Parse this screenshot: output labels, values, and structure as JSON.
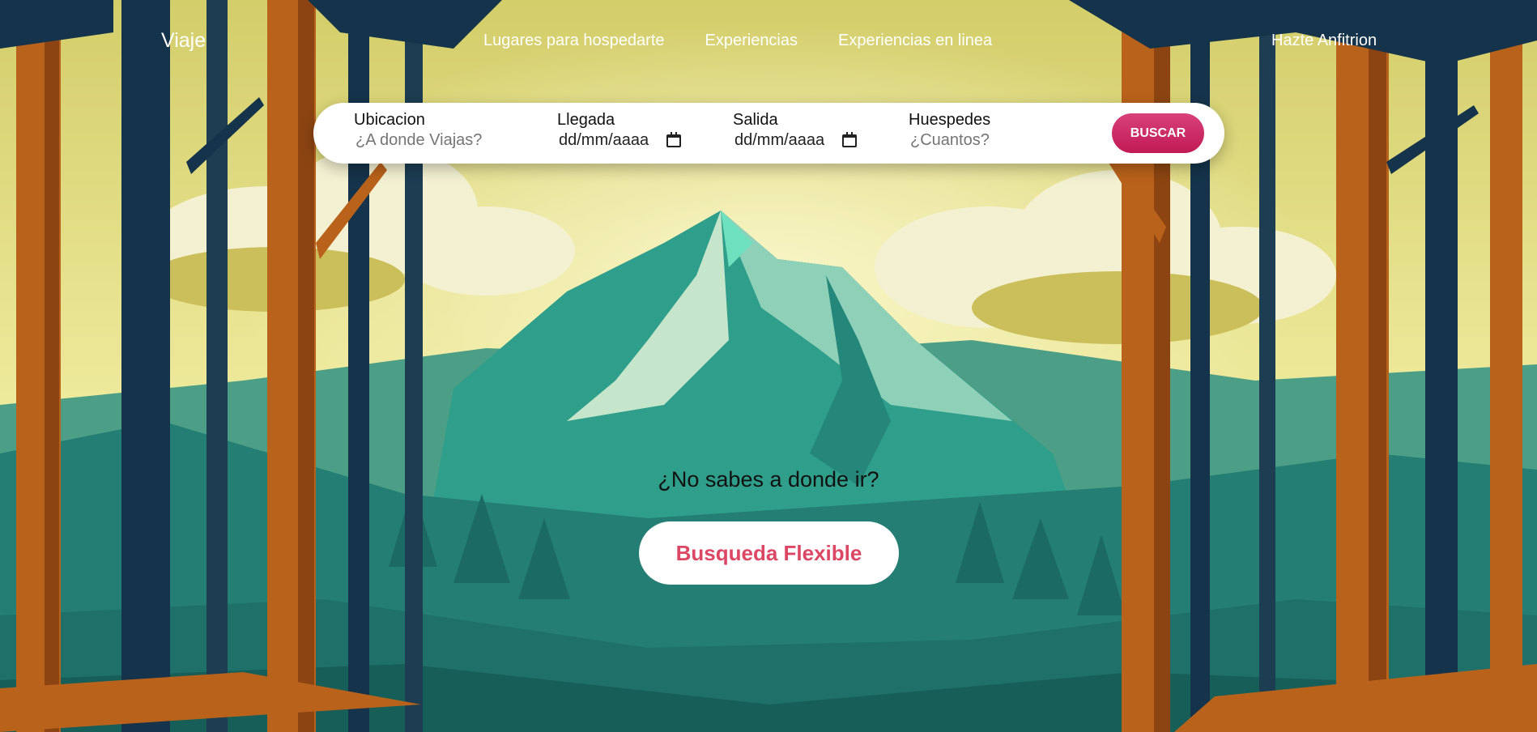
{
  "header": {
    "logo": "Viaje",
    "nav": [
      "Lugares para hospedarte",
      "Experiencias",
      "Experiencias en linea"
    ],
    "host_link": "Hazte Anfitrion"
  },
  "search": {
    "location": {
      "label": "Ubicacion",
      "placeholder": "¿A donde Viajas?"
    },
    "checkin": {
      "label": "Llegada",
      "value": "dd/mm/aaaa"
    },
    "checkout": {
      "label": "Salida",
      "value": "dd/mm/aaaa"
    },
    "guests": {
      "label": "Huespedes",
      "placeholder": "¿Cuantos?"
    },
    "button": "BUSCAR"
  },
  "cta": {
    "question": "¿No sabes a donde ir?",
    "button": "Busqueda Flexible"
  },
  "colors": {
    "accent": "#c81e5a",
    "cta_text": "#dc4766",
    "sky": "#e9e38c",
    "mountain": "#2f9e8a",
    "tree": "#b9621b"
  }
}
